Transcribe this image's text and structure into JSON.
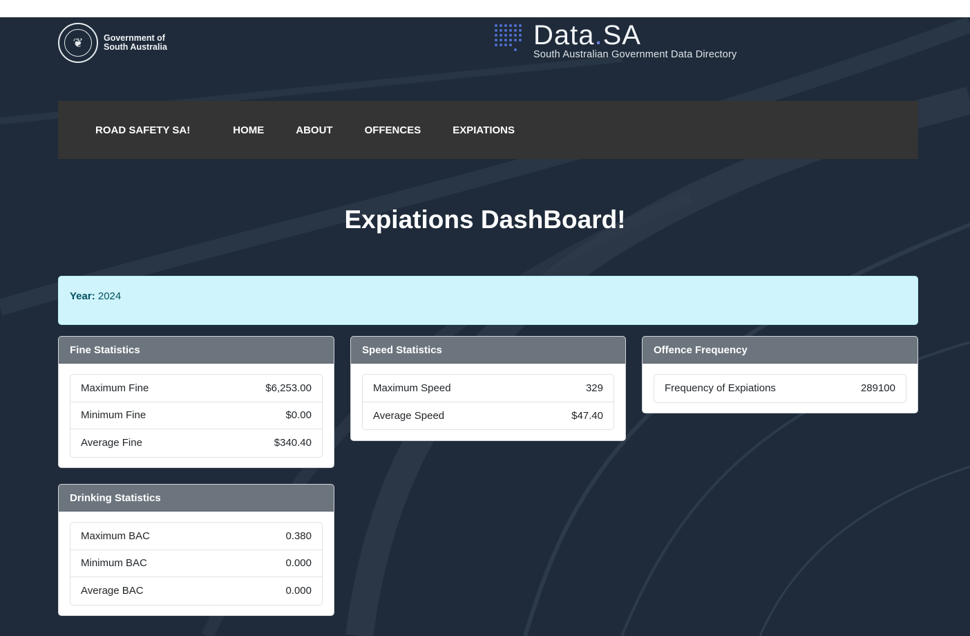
{
  "header": {
    "gov_line1": "Government of",
    "gov_line2": "South Australia",
    "datasa_name_a": "Data",
    "datasa_name_dot": ".",
    "datasa_name_b": "SA",
    "datasa_subtitle": "South Australian Government Data Directory"
  },
  "nav": {
    "brand": "ROAD SAFETY SA!",
    "items": [
      "HOME",
      "ABOUT",
      "OFFENCES",
      "EXPIATIONS"
    ]
  },
  "page": {
    "title": "Expiations DashBoard!",
    "year_label": "Year:",
    "year_value": "2024"
  },
  "cards": {
    "fine": {
      "title": "Fine Statistics",
      "rows": [
        {
          "label": "Maximum Fine",
          "value": "$6,253.00"
        },
        {
          "label": "Minimum Fine",
          "value": "$0.00"
        },
        {
          "label": "Average Fine",
          "value": "$340.40"
        }
      ]
    },
    "speed": {
      "title": "Speed Statistics",
      "rows": [
        {
          "label": "Maximum Speed",
          "value": "329"
        },
        {
          "label": "Average Speed",
          "value": "$47.40"
        }
      ]
    },
    "frequency": {
      "title": "Offence Frequency",
      "rows": [
        {
          "label": "Frequency of Expiations",
          "value": "289100"
        }
      ]
    },
    "drinking": {
      "title": "Drinking Statistics",
      "rows": [
        {
          "label": "Maximum BAC",
          "value": "0.380"
        },
        {
          "label": "Minimum BAC",
          "value": "0.000"
        },
        {
          "label": "Average BAC",
          "value": "0.000"
        }
      ]
    }
  },
  "colors": {
    "background": "#1f2b3a",
    "navbar": "#343434",
    "alert_info": "#cff4fc",
    "card_header": "#6c757d"
  }
}
